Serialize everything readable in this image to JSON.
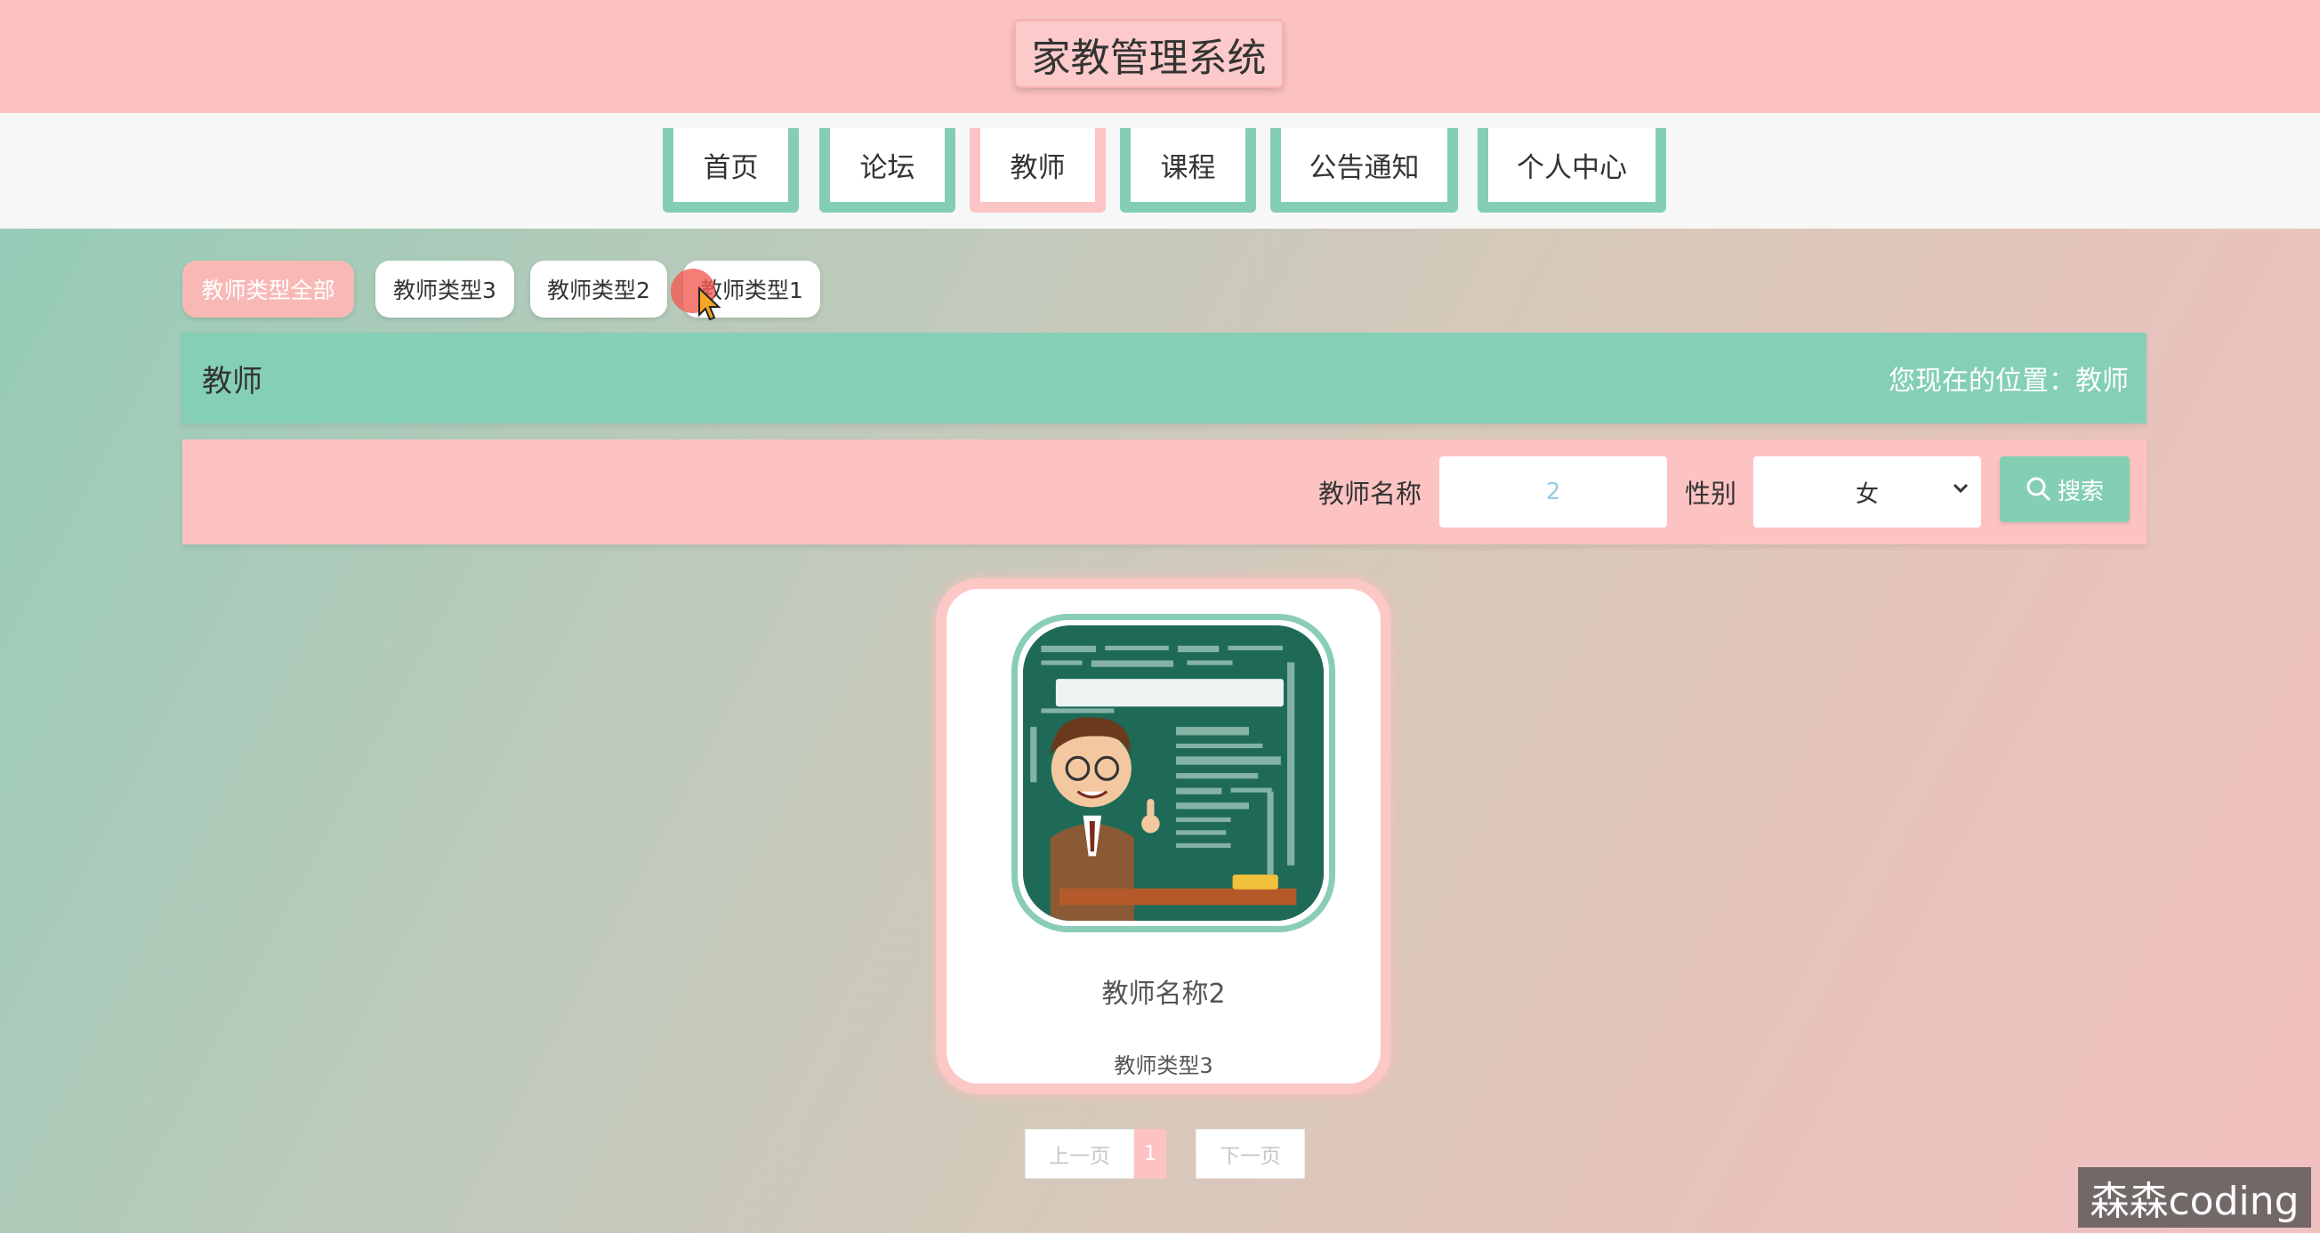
{
  "header": {
    "title": "家教管理系统"
  },
  "nav": {
    "items": [
      {
        "label": "首页"
      },
      {
        "label": "论坛"
      },
      {
        "label": "教师"
      },
      {
        "label": "课程"
      },
      {
        "label": "公告通知"
      },
      {
        "label": "个人中心"
      }
    ],
    "active": "教师"
  },
  "categories": {
    "items": [
      {
        "label": "教师类型全部"
      },
      {
        "label": "教师类型3"
      },
      {
        "label": "教师类型2"
      },
      {
        "label": "教师类型1"
      }
    ],
    "active": "教师类型全部"
  },
  "breadcrumb": {
    "title": "教师",
    "location": "您现在的位置：教师"
  },
  "search": {
    "name_label": "教师名称",
    "name_value": "2",
    "gender_label": "性别",
    "gender_value": "女",
    "button_label": "搜索"
  },
  "teachers": [
    {
      "name": "教师名称2",
      "type": "教师类型3",
      "image": "education-chalkboard-teacher"
    }
  ],
  "pagination": {
    "prev_label": "上一页",
    "current_page": "1",
    "next_label": "下一页"
  },
  "watermark": "森森coding",
  "colors": {
    "pink": "#fdc3c3",
    "mint": "#84cfb3",
    "white": "#ffffff"
  }
}
